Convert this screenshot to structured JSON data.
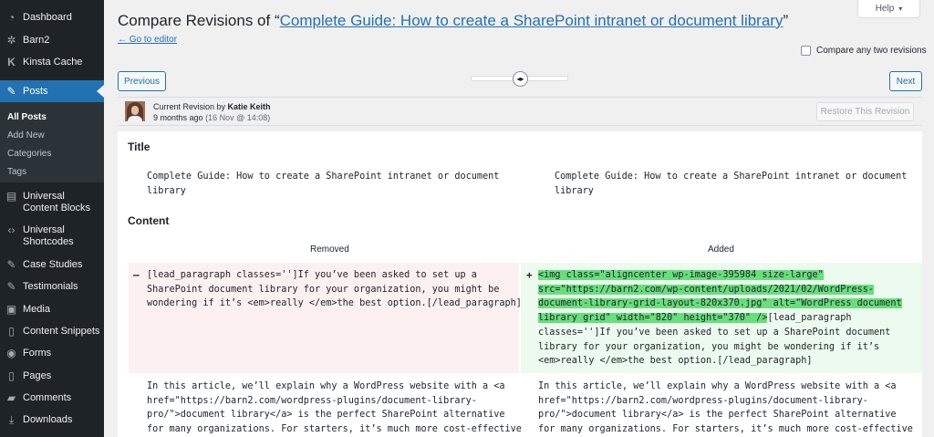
{
  "sidebar": {
    "items": [
      {
        "label": "Dashboard",
        "icon": "dashboard-icon"
      },
      {
        "label": "Barn2",
        "icon": "gear-icon"
      },
      {
        "label": "Kinsta Cache",
        "icon": "kinsta-icon"
      },
      {
        "label": "Posts",
        "icon": "pin-icon",
        "active": true
      },
      {
        "label": "Universal Content Blocks",
        "icon": "blocks-icon"
      },
      {
        "label": "Universal Shortcodes",
        "icon": "shortcode-icon"
      },
      {
        "label": "Case Studies",
        "icon": "pin-icon"
      },
      {
        "label": "Testimonials",
        "icon": "pin-icon"
      },
      {
        "label": "Media",
        "icon": "media-icon"
      },
      {
        "label": "Content Snippets",
        "icon": "page-icon"
      },
      {
        "label": "Forms",
        "icon": "forms-icon"
      },
      {
        "label": "Pages",
        "icon": "page-icon"
      },
      {
        "label": "Comments",
        "icon": "comment-icon"
      },
      {
        "label": "Downloads",
        "icon": "download-icon"
      }
    ],
    "submenu": [
      "All Posts",
      "Add New",
      "Categories",
      "Tags"
    ]
  },
  "header": {
    "title_prefix": "Compare Revisions of “",
    "title_link": "Complete Guide: How to create a SharePoint intranet or document library",
    "title_suffix": "”",
    "back_link": "← Go to editor",
    "help_label": "Help",
    "compare_any_label": "Compare any two revisions"
  },
  "nav": {
    "previous_label": "Previous",
    "next_label": "Next"
  },
  "revision": {
    "current_label": "Current Revision by",
    "author": "Katie Keith",
    "time_ago": "9 months ago",
    "date": "(16 Nov @ 14:08)",
    "restore_label": "Restore This Revision"
  },
  "diff": {
    "title_heading": "Title",
    "title_left": "Complete Guide: How to create a SharePoint intranet or document\nlibrary",
    "title_right": "Complete Guide: How to create a SharePoint intranet or document\nlibrary",
    "content_heading": "Content",
    "removed_label": "Removed",
    "added_label": "Added",
    "removed_sign": "–",
    "added_sign": "+",
    "removed_text": "[lead_paragraph classes='']If you’ve been asked to set up a\nSharePoint document library for your organization, you might be\nwondering if it’s <em>really </em>the best option.[/lead_paragraph]",
    "added_highlight_lines": [
      "<img class=\"aligncenter wp-image-395984 size-large\"",
      "src=\"https://barn2.com/wp-content/uploads/2021/02/WordPress-",
      "document-library-grid-layout-820x370.jpg\" alt=\"WordPress document",
      "library grid\" width=\"820\" height=\"370\" />"
    ],
    "added_after_highlight": "[lead_paragraph",
    "added_rest": "classes='']If you’ve been asked to set up a SharePoint document\nlibrary for your organization, you might be wondering if it’s\n<em>really </em>the best option.[/lead_paragraph]",
    "context_left": "In this article, we’ll explain why a WordPress website with a <a\nhref=\"https://barn2.com/wordpress-plugins/document-library-\npro/\">document library</a> is the perfect SharePoint alternative\nfor many organizations. For starters, it’s much more cost-effective",
    "context_right": "In this article, we’ll explain why a WordPress website with a <a\nhref=\"https://barn2.com/wordpress-plugins/document-library-\npro/\">document library</a> is the perfect SharePoint alternative\nfor many organizations. For starters, it’s much more cost-effective"
  },
  "colors": {
    "sidebar_bg": "#1d2327",
    "accent": "#2271b1",
    "removed_bg": "#fcf0f1",
    "added_bg": "#edfaef",
    "added_highlight": "#68de7c"
  }
}
